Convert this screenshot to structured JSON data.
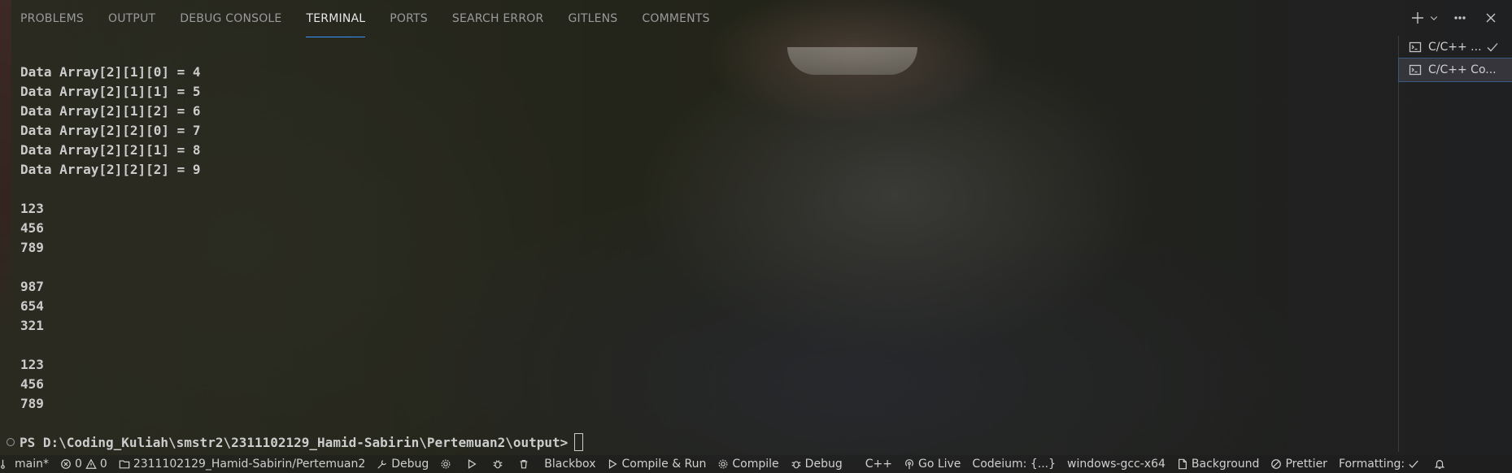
{
  "panel": {
    "tabs": [
      {
        "label": "PROBLEMS"
      },
      {
        "label": "OUTPUT"
      },
      {
        "label": "DEBUG CONSOLE"
      },
      {
        "label": "TERMINAL",
        "active": true
      },
      {
        "label": "PORTS"
      },
      {
        "label": "SEARCH ERROR"
      },
      {
        "label": "GITLENS"
      },
      {
        "label": "COMMENTS"
      }
    ],
    "actions": [
      "plus-icon",
      "chevron-down-icon",
      "more-icon",
      "close-icon"
    ]
  },
  "terminal": {
    "lines": [
      "Data Array[2][1][0] = 4",
      "Data Array[2][1][1] = 5",
      "Data Array[2][1][2] = 6",
      "Data Array[2][2][0] = 7",
      "Data Array[2][2][1] = 8",
      "Data Array[2][2][2] = 9",
      "",
      "123",
      "456",
      "789",
      "",
      "987",
      "654",
      "321",
      "",
      "123",
      "456",
      "789"
    ],
    "prompt": "PS D:\\Coding_Kuliah\\smstr2\\2311102129_Hamid-Sabirin\\Pertemuan2\\output>"
  },
  "terminal_list": {
    "items": [
      {
        "label": "C/C++ ...",
        "selected": false,
        "check": true
      },
      {
        "label": "C/C++ Co...",
        "selected": true,
        "check": false
      }
    ]
  },
  "statusbar": {
    "branch": "main*",
    "errors": "0",
    "warnings": "0",
    "folder": "2311102129_Hamid-Sabirin/Pertemuan2",
    "debug": "Debug",
    "blackbox": "Blackbox",
    "compile_run": "Compile & Run",
    "compile": "Compile",
    "debug2": "Debug",
    "language": "C++",
    "golive": "Go Live",
    "codeium": "Codeium: {...}",
    "compiler": "windows-gcc-x64",
    "background": "Background",
    "prettier": "Prettier",
    "formatting": "Formatting:"
  },
  "colors": {
    "accent": "#3794ff",
    "background": "#22231d"
  }
}
